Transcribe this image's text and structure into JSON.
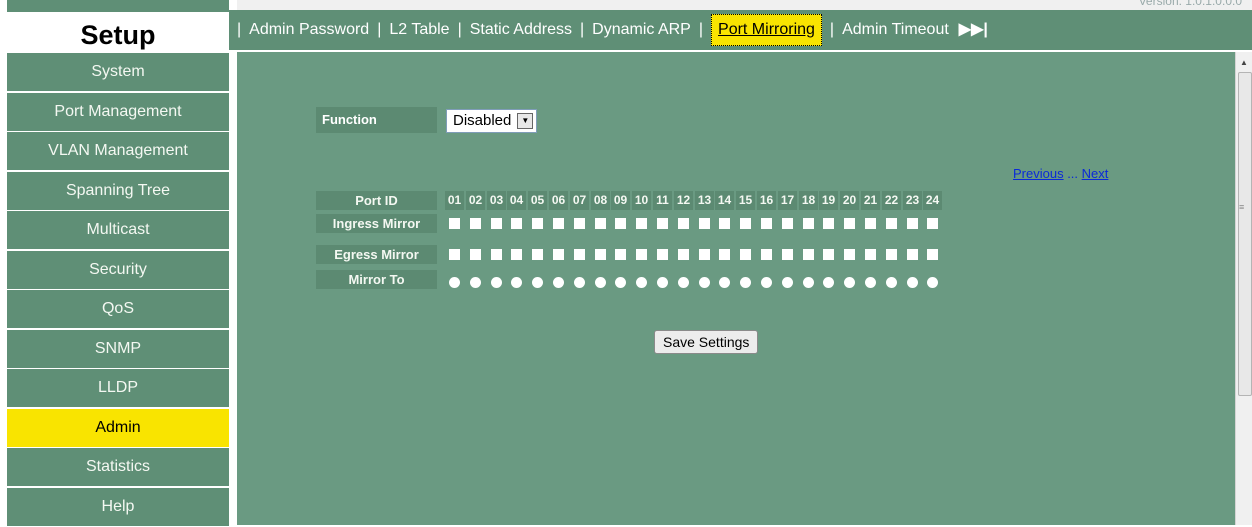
{
  "sidebar": {
    "title": "Setup",
    "items": [
      {
        "label": "System"
      },
      {
        "label": "Port Management"
      },
      {
        "label": "VLAN Management"
      },
      {
        "label": "Spanning Tree"
      },
      {
        "label": "Multicast"
      },
      {
        "label": "Security"
      },
      {
        "label": "QoS"
      },
      {
        "label": "SNMP"
      },
      {
        "label": "LLDP"
      },
      {
        "label": "Admin",
        "active": true
      },
      {
        "label": "Statistics"
      },
      {
        "label": "Help"
      }
    ]
  },
  "header": {
    "version": "Version: 1.0.1.0.0.0",
    "tabs": [
      {
        "label": "Admin Password"
      },
      {
        "label": "L2 Table"
      },
      {
        "label": "Static Address"
      },
      {
        "label": "Dynamic ARP"
      },
      {
        "label": "Port Mirroring",
        "active": true
      },
      {
        "label": "Admin Timeout"
      }
    ],
    "more_icon": "fast-forward-icon"
  },
  "function": {
    "label": "Function",
    "value": "Disabled",
    "options": [
      "Disabled"
    ]
  },
  "pager": {
    "previous": "Previous",
    "sep": " ... ",
    "next": "Next"
  },
  "table": {
    "port_id_label": "Port ID",
    "ingress_label": "Ingress Mirror",
    "egress_label": "Egress Mirror",
    "mirror_to_label": "Mirror To",
    "ports": [
      "01",
      "02",
      "03",
      "04",
      "05",
      "06",
      "07",
      "08",
      "09",
      "10",
      "11",
      "12",
      "13",
      "14",
      "15",
      "16",
      "17",
      "18",
      "19",
      "20",
      "21",
      "22",
      "23",
      "24"
    ]
  },
  "save_button": "Save Settings",
  "colors": {
    "green": "#5f8f76",
    "content": "#6a9a82",
    "active": "#f9e400",
    "link": "#0a2ad8"
  }
}
